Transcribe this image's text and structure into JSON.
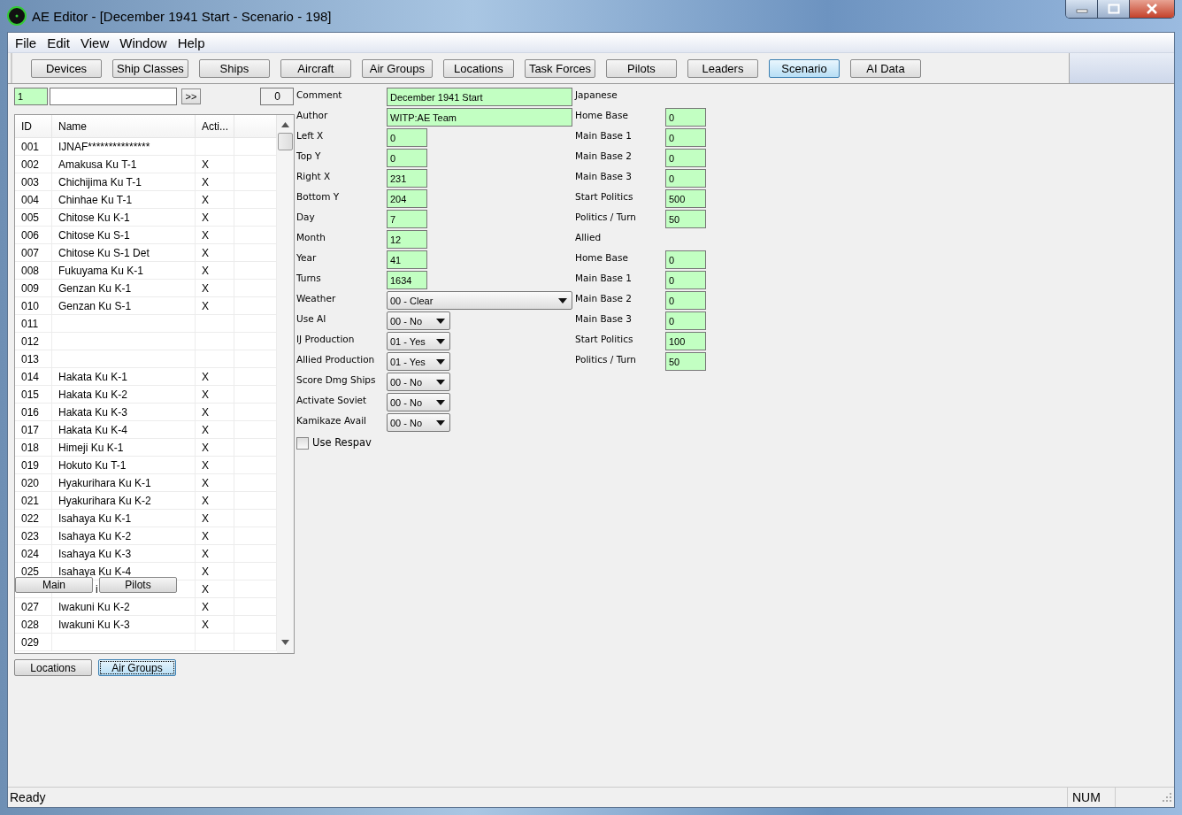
{
  "window": {
    "title": "AE Editor - [December 1941 Start - Scenario - 198]"
  },
  "menu": [
    "File",
    "Edit",
    "View",
    "Window",
    "Help"
  ],
  "toolbar": [
    {
      "label": "Devices",
      "selected": false
    },
    {
      "label": "Ship Classes",
      "selected": false
    },
    {
      "label": "Ships",
      "selected": false
    },
    {
      "label": "Aircraft",
      "selected": false
    },
    {
      "label": "Air Groups",
      "selected": false
    },
    {
      "label": "Locations",
      "selected": false
    },
    {
      "label": "Task Forces",
      "selected": false
    },
    {
      "label": "Pilots",
      "selected": false
    },
    {
      "label": "Leaders",
      "selected": false
    },
    {
      "label": "Scenario",
      "selected": true
    },
    {
      "label": "AI Data",
      "selected": false
    }
  ],
  "search": {
    "index": "1",
    "go": ">>",
    "count": "0"
  },
  "table": {
    "columns": [
      "ID",
      "Name",
      "Acti..."
    ],
    "rows": [
      {
        "id": "001",
        "name": "IJNAF***************"
      },
      {
        "id": "002",
        "name": "Amakusa Ku T-1",
        "active": "X"
      },
      {
        "id": "003",
        "name": "Chichijima Ku T-1",
        "active": "X"
      },
      {
        "id": "004",
        "name": "Chinhae Ku T-1",
        "active": "X"
      },
      {
        "id": "005",
        "name": "Chitose Ku K-1",
        "active": "X"
      },
      {
        "id": "006",
        "name": "Chitose Ku S-1",
        "active": "X"
      },
      {
        "id": "007",
        "name": "Chitose Ku S-1 Det",
        "active": "X"
      },
      {
        "id": "008",
        "name": "Fukuyama Ku K-1",
        "active": "X"
      },
      {
        "id": "009",
        "name": "Genzan Ku K-1",
        "active": "X"
      },
      {
        "id": "010",
        "name": "Genzan Ku S-1",
        "active": "X"
      },
      {
        "id": "011"
      },
      {
        "id": "012"
      },
      {
        "id": "013"
      },
      {
        "id": "014",
        "name": "Hakata Ku K-1",
        "active": "X"
      },
      {
        "id": "015",
        "name": "Hakata Ku K-2",
        "active": "X"
      },
      {
        "id": "016",
        "name": "Hakata Ku K-3",
        "active": "X"
      },
      {
        "id": "017",
        "name": "Hakata Ku K-4",
        "active": "X"
      },
      {
        "id": "018",
        "name": "Himeji Ku K-1",
        "active": "X"
      },
      {
        "id": "019",
        "name": "Hokuto Ku T-1",
        "active": "X"
      },
      {
        "id": "020",
        "name": "Hyakurihara Ku K-1",
        "active": "X"
      },
      {
        "id": "021",
        "name": "Hyakurihara Ku K-2",
        "active": "X"
      },
      {
        "id": "022",
        "name": "Isahaya Ku K-1",
        "active": "X"
      },
      {
        "id": "023",
        "name": "Isahaya Ku K-2",
        "active": "X"
      },
      {
        "id": "024",
        "name": "Isahaya Ku K-3",
        "active": "X"
      },
      {
        "id": "025",
        "name": "Isahaya Ku K-4",
        "active": "X"
      },
      {
        "kind": "covered",
        "name": "i",
        "active": "X"
      },
      {
        "id": "027",
        "name": "Iwakuni Ku K-2",
        "active": "X"
      },
      {
        "id": "028",
        "name": "Iwakuni Ku K-3",
        "active": "X"
      },
      {
        "id": "029"
      }
    ]
  },
  "overlay_buttons": [
    "Main",
    "Pilots"
  ],
  "list_tabs": [
    {
      "label": "Locations",
      "selected": false
    },
    {
      "label": "Air Groups",
      "selected": true
    }
  ],
  "form": [
    {
      "label": "Comment",
      "kind": "field",
      "wide": true,
      "value": "December 1941 Start"
    },
    {
      "label": "Author",
      "kind": "field",
      "wide": true,
      "value": "WITP:AE Team"
    },
    {
      "label": "Left X",
      "kind": "field",
      "value": "0"
    },
    {
      "label": "Top Y",
      "kind": "field",
      "value": "0"
    },
    {
      "label": "Right X",
      "kind": "field",
      "value": "231"
    },
    {
      "label": "Bottom Y",
      "kind": "field",
      "value": "204"
    },
    {
      "label": "Day",
      "kind": "field",
      "value": "7"
    },
    {
      "label": "Month",
      "kind": "field",
      "value": "12"
    },
    {
      "label": "Year",
      "kind": "field",
      "value": "41"
    },
    {
      "label": "Turns",
      "kind": "field",
      "value": "1634"
    },
    {
      "label": "Weather",
      "kind": "select",
      "wide": true,
      "value": "00 - Clear"
    },
    {
      "label": "Use AI",
      "kind": "select",
      "value": "00 - No"
    },
    {
      "label": "IJ Production",
      "kind": "select",
      "value": "01 - Yes"
    },
    {
      "label": "Allied Production",
      "kind": "select",
      "value": "01 - Yes"
    },
    {
      "label": "Score Dmg Ships",
      "kind": "select",
      "value": "00 - No"
    },
    {
      "label": "Activate Soviet",
      "kind": "select",
      "value": "00 - No"
    },
    {
      "label": "Kamikaze Avail",
      "kind": "select",
      "value": "00 - No"
    },
    {
      "label": "Use Respav",
      "kind": "checkbox",
      "checked": false
    }
  ],
  "sides": [
    {
      "label": "Japanese",
      "kind": "heading"
    },
    {
      "label": "Home Base",
      "kind": "field",
      "value": "0"
    },
    {
      "label": "Main Base 1",
      "kind": "field",
      "value": "0"
    },
    {
      "label": "Main Base 2",
      "kind": "field",
      "value": "0"
    },
    {
      "label": "Main Base 3",
      "kind": "field",
      "value": "0"
    },
    {
      "label": "Start Politics",
      "kind": "field",
      "value": "500"
    },
    {
      "label": "Politics / Turn",
      "kind": "field",
      "value": "50"
    },
    {
      "label": "Allied",
      "kind": "heading"
    },
    {
      "label": "Home Base",
      "kind": "field",
      "value": "0"
    },
    {
      "label": "Main Base 1",
      "kind": "field",
      "value": "0"
    },
    {
      "label": "Main Base 2",
      "kind": "field",
      "value": "0"
    },
    {
      "label": "Main Base 3",
      "kind": "field",
      "value": "0"
    },
    {
      "label": "Start Politics",
      "kind": "field",
      "value": "100"
    },
    {
      "label": "Politics / Turn",
      "kind": "field",
      "value": "50"
    }
  ],
  "status_bar": {
    "message": "Ready",
    "indicator": "NUM"
  }
}
